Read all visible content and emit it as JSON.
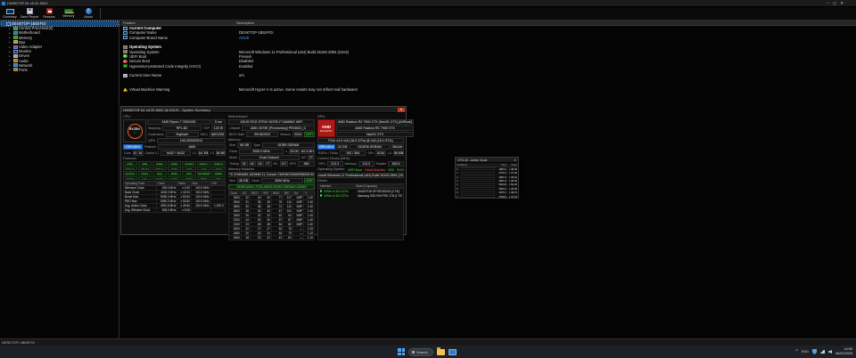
{
  "window": {
    "title": "HWiNFO® 64 v8.20-5840",
    "minimize": "–",
    "maximize": "▢",
    "close": "✕"
  },
  "toolbar": {
    "buttons": [
      {
        "label": "Summary"
      },
      {
        "label": "Save Report"
      },
      {
        "label": "Sensors"
      },
      {
        "label": "Memory"
      },
      {
        "label": "About"
      }
    ]
  },
  "tree": {
    "root": {
      "label": "DESKTOP-1B5XFGI",
      "icon": "computer-icon"
    },
    "items": [
      {
        "label": "Central Processor(s)",
        "icon": "cpu-icon"
      },
      {
        "label": "Motherboard",
        "icon": "motherboard-icon"
      },
      {
        "label": "Memory",
        "icon": "memory-icon"
      },
      {
        "label": "Bus",
        "icon": "bus-icon"
      },
      {
        "label": "Video Adapter",
        "icon": "video-icon"
      },
      {
        "label": "Monitor",
        "icon": "monitor-icon"
      },
      {
        "label": "Drives",
        "icon": "drives-icon"
      },
      {
        "label": "Audio",
        "icon": "audio-icon"
      },
      {
        "label": "Network",
        "icon": "network-icon"
      },
      {
        "label": "Ports",
        "icon": "ports-icon"
      }
    ]
  },
  "list": {
    "header_feature": "Feature",
    "header_description": "Description",
    "rows": [
      {
        "icon": "computer-icon",
        "label": "Current Computer",
        "desc": "",
        "cls": "section"
      },
      {
        "icon": "monitor-icon",
        "label": "Computer Name",
        "desc": "DESKTOP-1B5XFGI"
      },
      {
        "icon": "monitor-icon",
        "label": "Computer Brand Name",
        "desc": "ASUS",
        "dcls": "link"
      },
      {
        "label": "",
        "desc": ""
      },
      {
        "icon": "windows-icon",
        "label": "Operating System",
        "desc": "",
        "cls": "section"
      },
      {
        "icon": "windows-icon",
        "label": "Operating System",
        "desc": "Microsoft Windows 11 Professional (x64) Build 26100.2894 (24H2)"
      },
      {
        "icon": "green-ball-icon",
        "label": "UEFI Boot",
        "desc": "Present"
      },
      {
        "icon": "red-ball-icon",
        "label": "Secure Boot",
        "desc": "Disabled"
      },
      {
        "icon": "green-led-icon",
        "label": "Hypervisor-protected Code Integrity (HVCI)",
        "desc": "Enabled"
      },
      {
        "label": "",
        "desc": ""
      },
      {
        "icon": "user-icon",
        "label": "Current User Name",
        "desc": "om"
      },
      {
        "label": "",
        "desc": ""
      },
      {
        "label": "",
        "desc": ""
      },
      {
        "icon": "warning-icon",
        "label": "Virtual Machine Warning",
        "desc": "Microsoft Hyper-V is active. Some results may not reflect real hardware!"
      }
    ]
  },
  "statusbar": {
    "text": "DESKTOP-1B5XFGI"
  },
  "summary": {
    "title": "HWiNFO® 64 v8.20-5840 @ ASUS  -  System Summary",
    "close": "✕",
    "cpu": {
      "section_label": "CPU",
      "logo_text": "RYZEN",
      "logo_sub": "7",
      "name": "AMD Ryzen 7 7800X3D",
      "process": "5 nm",
      "stepping_label": "Stepping",
      "stepping": "RPL-B2",
      "tdp_label": "TDP",
      "tdp": "120 W",
      "codename_label": "Codename",
      "codename": "Raphael",
      "mcu_label": "MCU",
      "mcu": "A601206",
      "qpn_label": "QPN",
      "qpn": "100-000000910",
      "selector": "CPU #0",
      "platform_label": "Platform",
      "platform": "AM5",
      "core_label": "Core",
      "core": "8 / 16",
      "l1_label": "Cache L1",
      "l1": "8x32 + 8x32",
      "l2_label": "L2",
      "l2": "8x1 MB",
      "l3_label": "L3",
      "l3": "96 MB",
      "features_label": "Features",
      "features": [
        "MMX",
        "SSE",
        "SSE2",
        "SSE3",
        "SSSE3",
        "SSE4.1",
        "SSE4.2",
        "SSE4A",
        "x86-64",
        "AMD-V",
        "SMT",
        "AES",
        "AVX",
        "AVX2",
        "AVX512",
        "FMA3",
        "SHA",
        "BMI2",
        "ADX",
        "RDSEED",
        "SMEP",
        "SMAP",
        "NX",
        "VAES",
        "GFNI",
        "CPPC",
        "PPIN",
        "TSC"
      ],
      "op_headers": [
        "Operating Point",
        "Clock",
        "Ratio",
        "Bus",
        "VID"
      ],
      "op_rows": [
        {
          "name": "Minimum Clock",
          "clock": "400.0 MHz",
          "ratio": "x 4.00",
          "bus": "100.0 MHz",
          "extra": ""
        },
        {
          "name": "Base Clock",
          "clock": "4200.0 MHz",
          "ratio": "x 42.00",
          "bus": "100.0 MHz",
          "extra": ""
        },
        {
          "name": "Boost Max",
          "clock": "5050.0 MHz",
          "ratio": "x 50.50",
          "bus": "100.0 MHz",
          "extra": ""
        },
        {
          "name": "PBO Max",
          "clock": "5050.0 MHz",
          "ratio": "x 50.50",
          "bus": "100.0 MHz",
          "extra": ""
        },
        {
          "name": "Avg. Active Clock",
          "clock": "4951.8 MHz",
          "ratio": "x 49.56",
          "bus": "100.0 MHz",
          "extra": "1.199 V"
        },
        {
          "name": "Avg. Effective Clock",
          "clock": "506.3 MHz",
          "ratio": "x 5.06",
          "bus": "",
          "extra": ""
        }
      ]
    },
    "mb": {
      "section_label": "Motherboard",
      "name": "ASUS ROG STRIX X670E-F GAMING WIFI",
      "chipset_label": "Chipset",
      "chipset": "AMD X670E (Promontory) PROM21_D",
      "bios_label": "BIOS Date",
      "bios_date": "09/18/2023",
      "version_label": "Version",
      "version": "2204",
      "uefi_badge": "UEFI",
      "memory_label": "Memory",
      "size_label": "Size",
      "size": "96 GB",
      "type_label": "Type",
      "type": "DDR5 SDRAM",
      "clock_label": "Clock",
      "clock": "3000.0 MHz",
      "ratio_label": "x",
      "ratio": "30.00",
      "busclk": "100.3 MHz",
      "mode_label": "Mode",
      "mode": "Dual Channel",
      "cr_label": "CR",
      "cr": "2T",
      "timing_label": "Timing",
      "tcl": "32",
      "trcd": "40",
      "trp": "40",
      "tras": "77",
      "rc_label": "RC",
      "trc": "117",
      "rfc_label": "RFC",
      "trfc": "560",
      "modules_label": "Memory Modules",
      "module_select": "#1 [P0 CHANNEL A/DIMM 1]: Corsair CMK96GX5M2B5600C40 ()",
      "msize_label": "Size",
      "msize": "48 GB",
      "mclock_label": "Clock",
      "mclock": "3000 MHz",
      "xmp_badge": "XMP",
      "module_line": "DDR5-6000 / PC5-48000 DDR5 SDRAM UDIMM",
      "spd_headers": [
        "Clock",
        "tCL",
        "tRCD",
        "tRP",
        "tRAS",
        "tRC",
        "Src",
        "V"
      ],
      "spd_rows": [
        {
          "c": "3000",
          "cl": "32",
          "rcd": "40",
          "rp": "40",
          "ras": "77",
          "rc": "117",
          "s": "XMP",
          "v": "1.40"
        },
        {
          "c": "2900",
          "cl": "31",
          "rcd": "39",
          "rp": "39",
          "ras": "75",
          "rc": "114",
          "s": "XMP",
          "v": "1.40"
        },
        {
          "c": "2800",
          "cl": "30",
          "rcd": "38",
          "rp": "38",
          "ras": "72",
          "rc": "110",
          "s": "XMP",
          "v": "1.40"
        },
        {
          "c": "2600",
          "cl": "28",
          "rcd": "35",
          "rp": "35",
          "ras": "67",
          "rc": "102",
          "s": "XMP",
          "v": "1.40"
        },
        {
          "c": "2400",
          "cl": "26",
          "rcd": "32",
          "rp": "32",
          "ras": "62",
          "rc": "94",
          "s": "XMP",
          "v": "1.40"
        },
        {
          "c": "2200",
          "cl": "24",
          "rcd": "30",
          "rp": "30",
          "ras": "57",
          "rc": "87",
          "s": "XMP",
          "v": "1.40"
        },
        {
          "c": "2100",
          "cl": "23",
          "rcd": "28",
          "rp": "28",
          "ras": "54",
          "rc": "82",
          "s": "XMP",
          "v": "1.40"
        },
        {
          "c": "2000",
          "cl": "22",
          "rcd": "27",
          "rp": "27",
          "ras": "52",
          "rc": "78",
          "s": "—",
          "v": "1.25"
        },
        {
          "c": "1800",
          "cl": "20",
          "rcd": "24",
          "rp": "24",
          "ras": "46",
          "rc": "70",
          "s": "—",
          "v": "1.10"
        },
        {
          "c": "1600",
          "cl": "18",
          "rcd": "22",
          "rp": "22",
          "ras": "42",
          "rc": "62",
          "s": "—",
          "v": "1.10"
        }
      ]
    },
    "gpu": {
      "section_label": "GPU",
      "logo_line1": "AMD",
      "logo_line2": "RADEON",
      "full_name": "AMD Radeon RX 7900 XTX (Navi31 XTX) [ASRock]",
      "name": "AMD Radeon RX 7900 XTX",
      "chip": "Navi31 XTX",
      "pcie": "PCIe v4.0 x16 (16.0 GT/s) @ x16 (16.0 GT/s)",
      "selector": "GPU #0",
      "vram": "24 GB",
      "vram_type": "GDDR6 SDRAM",
      "bus_width": "384-bit",
      "rops_label": "ROPs / TMUs",
      "rops": "192 / 384",
      "shaders_label": "SPs",
      "shaders": "6144",
      "l3_label": "L3",
      "l3": "96 MB",
      "clocks_label": "Current Clocks [MHz]",
      "gclk_label": "GPU",
      "gclk": "313.3",
      "mclk_label": "Memory",
      "mclk": "113.3",
      "sclk_label": "Shader",
      "sclk": "626.6",
      "os_label": "Operating System",
      "os_status": [
        {
          "text": "UEFI Boot",
          "color": "st-green"
        },
        {
          "text": "Virtual Machine",
          "color": "st-red"
        },
        {
          "text": "VBS",
          "color": "st-green"
        },
        {
          "text": "HVCI",
          "color": "st-green"
        }
      ],
      "os_value": "Microsoft Windows 11 Professional (x64) Build 26100.2894 (24H2)",
      "drives_label": "Drives",
      "drives_headers": {
        "iface": "Interface",
        "model": "Model [Capacity]"
      },
      "drives": [
        {
          "iface": "NVMe v4 16.0 GT/s",
          "model": "KINGSTON SFYRD2000G [2 TB]"
        },
        {
          "iface": "NVMe v4 16.0 GT/s",
          "model": "Samsung SSD 990 PRO 1TB [1 TB]"
        }
      ]
    }
  },
  "clock_window": {
    "title": "CPU #0 - Active Clock",
    "close": "✕",
    "headers": [
      "Core",
      "Clock",
      "MHz",
      "Ratio"
    ],
    "rows": [
      {
        "core": "0",
        "pct": 86,
        "mhz": "4850.2",
        "ratio": "x 48.50"
      },
      {
        "core": "1",
        "pct": 76,
        "mhz": "4725.4",
        "ratio": "x 47.25"
      },
      {
        "core": "2",
        "pct": 91,
        "mhz": "4901.6",
        "ratio": "x 49.02"
      },
      {
        "core": "3",
        "pct": 71,
        "mhz": "4651.9",
        "ratio": "x 46.52"
      },
      {
        "core": "4",
        "pct": 96,
        "mhz": "5024.8",
        "ratio": "x 50.25"
      },
      {
        "core": "5",
        "pct": 66,
        "mhz": "4550.3",
        "ratio": "x 45.50"
      },
      {
        "core": "6",
        "pct": 88,
        "mhz": "4875.1",
        "ratio": "x 48.75"
      },
      {
        "core": "7",
        "pct": 81,
        "mhz": "4790.6",
        "ratio": "x 47.91"
      }
    ]
  },
  "taskbar": {
    "search_label": "Search",
    "tray": {
      "chevron": "^",
      "lang": "ENG",
      "time": "14:50",
      "date": "06/02/2025"
    }
  }
}
